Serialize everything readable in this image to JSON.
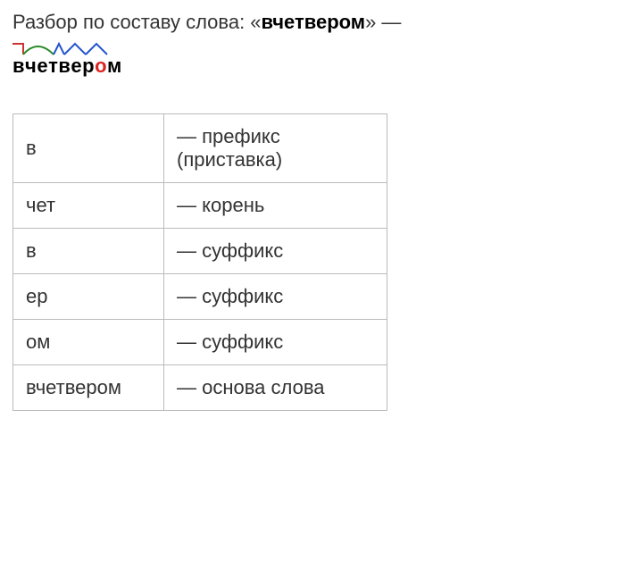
{
  "heading": {
    "prefix": "Разбор по составу слова: «",
    "word": "вчетвером",
    "suffix": "» —"
  },
  "morpheme_word": {
    "display": "вчетвером",
    "chars": [
      "в",
      "ч",
      "е",
      "т",
      "в",
      "е",
      "р",
      "о",
      "м"
    ],
    "highlight_index": 7
  },
  "table": {
    "rows": [
      {
        "part": "в",
        "desc": "префикс (приставка)"
      },
      {
        "part": "чет",
        "desc": "корень"
      },
      {
        "part": "в",
        "desc": "суффикс"
      },
      {
        "part": "ер",
        "desc": "суффикс"
      },
      {
        "part": "ом",
        "desc": "суффикс"
      },
      {
        "part": "вчетвером",
        "desc": "основа слова"
      }
    ]
  }
}
